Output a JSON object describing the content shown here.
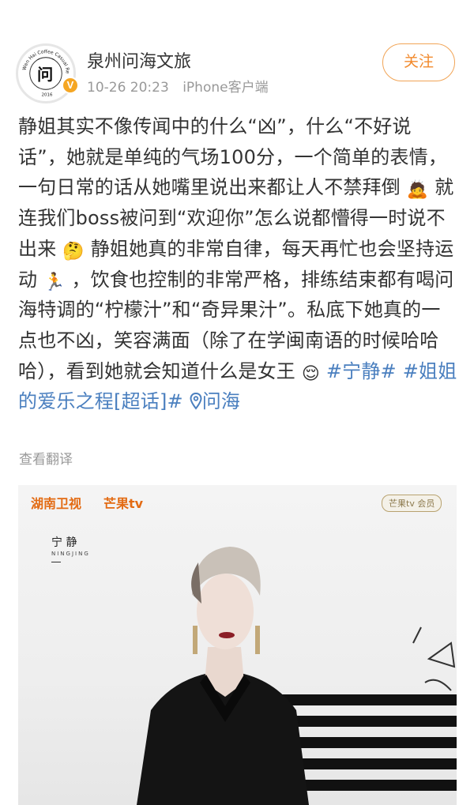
{
  "post": {
    "author": "泉州问海文旅",
    "time": "10-26 20:23",
    "source": "iPhone客户端",
    "follow_label": "关注",
    "verified_icon": "v-badge",
    "avatar_text": "Wen Hai Coffee Casual Restaurant",
    "avatar_year": "2016",
    "text_segments": {
      "p1": "静姐其实不像传闻中的什么“凶”，什么“不好说话”，她就是单纯的气场100分，一个简单的表情，一句日常的话从她嘴里说出来都让人不禁拜倒",
      "emoji1": "🙇",
      "p2": "就连我们boss被问到“欢迎你”怎么说都懵得一时说不出来",
      "emoji2": "🤔",
      "p3": "静姐她真的非常自律，每天再忙也会坚持运动",
      "emoji3": "🏃",
      "p4": "，饮食也控制的非常严格，排练结束都有喝问海特调的“柠檬汁”和“奇异果汁”。私底下她真的一点也不凶，笑容满面（除了在学闽南语的时候哈哈哈），看到她就会知道什么是女王",
      "emoji4": "😌",
      "hashtag1": "#宁静#",
      "hashtag2": "#姐姐的爱乐之程[超话]#",
      "location_icon": "location-pin-icon",
      "location": "问海"
    },
    "translate_label": "查看翻译"
  },
  "poster": {
    "logo_hunan": "湖南卫视",
    "logo_mango": "芒果tv",
    "logo_member": "芒果tv 会员",
    "star_name": "宁 静",
    "star_pinyin": "NINGJING",
    "star_dash": "—"
  }
}
